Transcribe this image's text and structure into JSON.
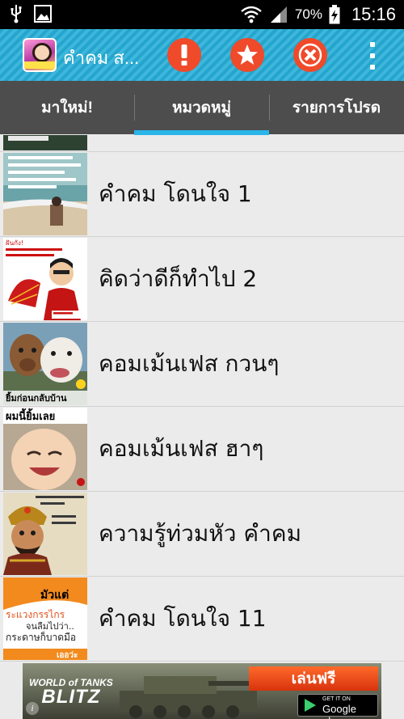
{
  "status_bar": {
    "battery_percent": "70%",
    "time": "15:16",
    "icons": [
      "usb-icon",
      "image-icon",
      "wifi-icon",
      "signal-icon",
      "battery-charging-icon"
    ]
  },
  "action_bar": {
    "title": "คำคม ส...",
    "buttons": [
      "alert-icon",
      "star-icon",
      "close-icon",
      "overflow-menu-icon"
    ],
    "accent": "#ef4a2a"
  },
  "tabs": {
    "items": [
      {
        "label": "มาใหม่!"
      },
      {
        "label": "หมวดหมู่"
      },
      {
        "label": "รายการโปรด"
      }
    ],
    "selected": 1,
    "indicator_color": "#29b5e8"
  },
  "list": {
    "items": [
      {
        "label": "คำคม โดนใจ 1"
      },
      {
        "label": "คิดว่าดีก็ทำไป 2"
      },
      {
        "label": "คอมเม้นเฟส กวนๆ"
      },
      {
        "label": "คอมเม้นเฟส ฮาๆ"
      },
      {
        "label": "ความรู้ท่วมหัว คำคม"
      },
      {
        "label": "คำคม โดนใจ 11"
      }
    ],
    "thumb_text": {
      "t2_top": "ฝันกัง!",
      "t3_caption": "ยิ้มก่อนกลับบ้าน",
      "t4_caption": "ผมนี้ยิ้มเลย",
      "t6_line1": "มัวแต่",
      "t6_line2": "ระแวงกรรไกร",
      "t6_line3": "จนลืมไปว่า..",
      "t6_line4": "กระดาษก็บาดมือ",
      "t6_brand": "เออว่ะ"
    }
  },
  "ad": {
    "logo_line1": "WORLD of TANKS",
    "logo_line2": "BLITZ",
    "play_label": "เล่นฟรี",
    "store_small": "GET IT ON",
    "store_big": "Google play",
    "info_glyph": "i"
  }
}
